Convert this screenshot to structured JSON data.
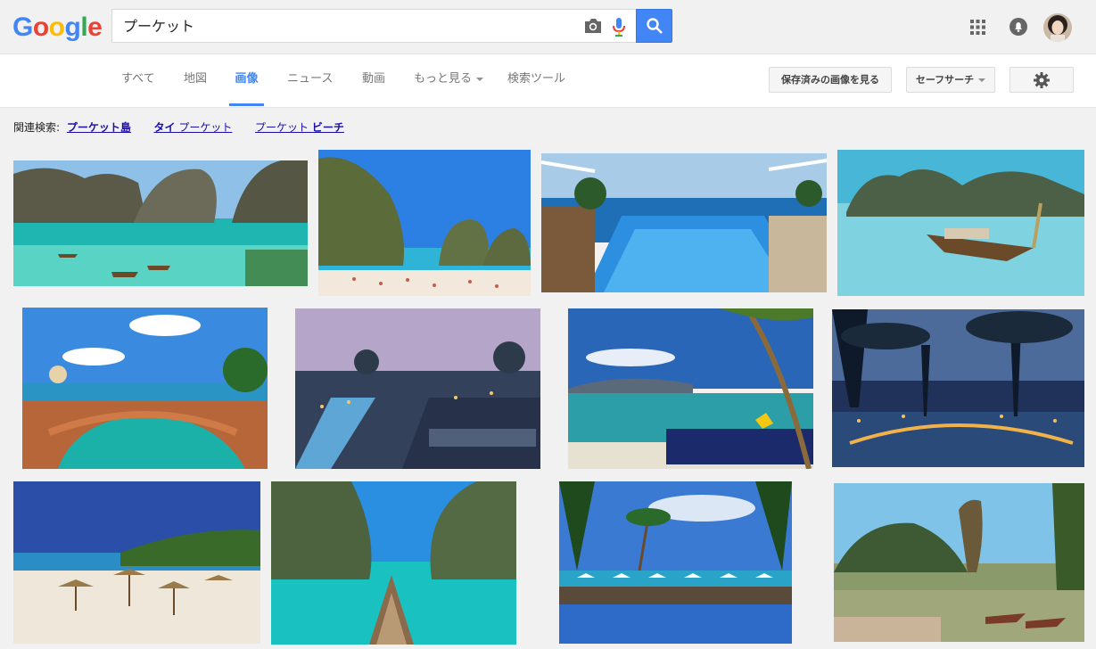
{
  "header": {
    "logo_letters": [
      {
        "ch": "G",
        "color": "#4285f4"
      },
      {
        "ch": "o",
        "color": "#ea4335"
      },
      {
        "ch": "o",
        "color": "#fbbc05"
      },
      {
        "ch": "g",
        "color": "#4285f4"
      },
      {
        "ch": "l",
        "color": "#34a853"
      },
      {
        "ch": "e",
        "color": "#ea4335"
      }
    ],
    "search_value": "プーケット",
    "accent": "#4285f4"
  },
  "nav": {
    "tabs": {
      "all": "すべて",
      "maps": "地図",
      "images": "画像",
      "news": "ニュース",
      "videos": "動画",
      "more": "もっと見る",
      "tools": "検索ツール"
    },
    "saved_images_button": "保存済みの画像を見る",
    "safesearch_button": "セーフサーチ"
  },
  "related": {
    "label": "関連検索:",
    "links": [
      {
        "bold_prefix": "プーケット島",
        "normal": "",
        "bold_suffix": ""
      },
      {
        "bold_prefix": "タイ",
        "normal": " プーケット",
        "bold_suffix": ""
      },
      {
        "bold_prefix": "",
        "normal": "プーケット ",
        "bold_suffix": "ビーチ"
      }
    ]
  },
  "results": {
    "images": [
      {
        "scene": "bay-cliffs-boats"
      },
      {
        "scene": "cliff-beach-crowd"
      },
      {
        "scene": "infinity-pool-sea"
      },
      {
        "scene": "longtail-boat-lagoon"
      },
      {
        "scene": "resort-pool-bridge"
      },
      {
        "scene": "dusk-resort-pool"
      },
      {
        "scene": "palm-beach-lounge"
      },
      {
        "scene": "night-palm-pool"
      },
      {
        "scene": "beach-umbrellas"
      },
      {
        "scene": "boat-bow-lagoon"
      },
      {
        "scene": "palm-resort-pool"
      },
      {
        "scene": "rock-island-boats"
      }
    ]
  }
}
